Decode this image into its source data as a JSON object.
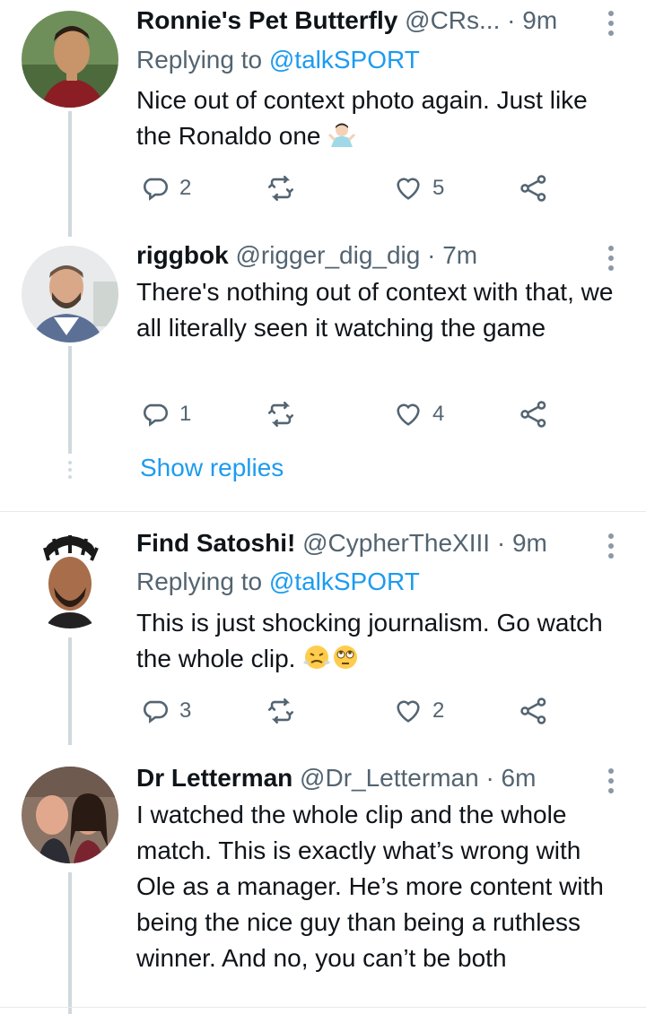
{
  "tweets": [
    {
      "name": "Ronnie's Pet Butterfly",
      "handle": "@CRs...",
      "dot": "·",
      "time": "9m",
      "replying_prefix": "Replying to",
      "replying_to": "@talkSPORT",
      "text": "Nice out of context photo again. Just like the Ronaldo one",
      "emojis": [
        "person-shrugging-emoji"
      ],
      "replies": "2",
      "retweets": "",
      "likes": "5"
    },
    {
      "name": "riggbok",
      "handle": "@rigger_dig_dig",
      "dot": "·",
      "time": "7m",
      "text": "There's nothing out of context with that, we all literally seen it watching the game",
      "replies": "1",
      "retweets": "",
      "likes": "4",
      "show_replies": "Show replies"
    },
    {
      "name": "Find Satoshi!",
      "handle": "@CypherTheXIII",
      "dot": "·",
      "time": "9m",
      "replying_prefix": "Replying to",
      "replying_to": "@talkSPORT",
      "text": "This is just shocking journalism. Go watch the whole clip.",
      "emojis": [
        "face-with-steam-emoji",
        "face-rolling-eyes-emoji"
      ],
      "replies": "3",
      "retweets": "",
      "likes": "2"
    },
    {
      "name": "Dr Letterman",
      "handle": "@Dr_Letterman",
      "dot": "·",
      "time": "6m",
      "text": "I watched the whole clip and the whole match. This is exactly what’s wrong with Ole as a manager. He’s more content with being the nice guy than being a ruthless winner. And no, you can’t be both"
    }
  ],
  "colors": {
    "link": "#1d9bf0",
    "muted": "#536471",
    "thread_line": "#cfd9de",
    "text": "#0f1419"
  }
}
